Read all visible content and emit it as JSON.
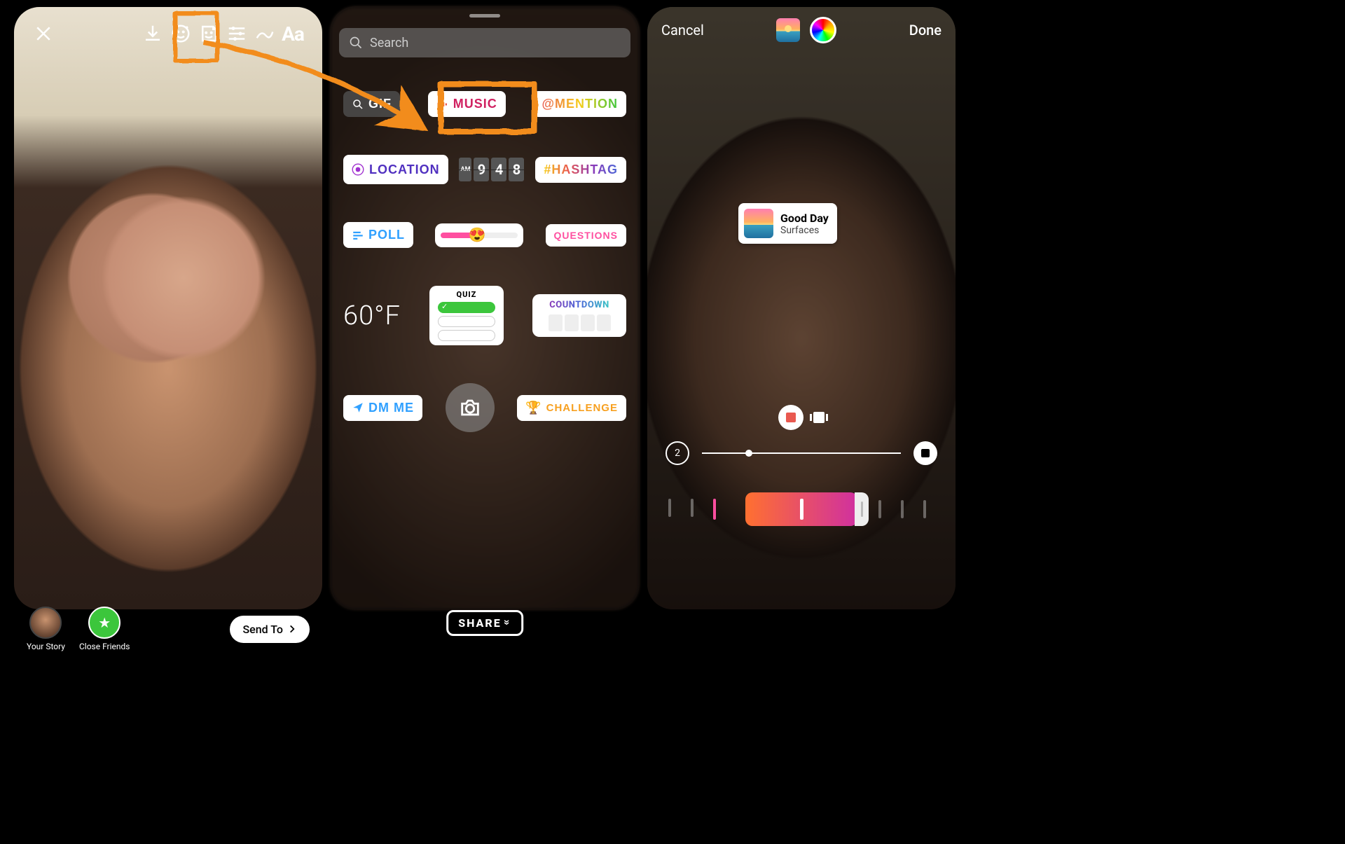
{
  "screen1": {
    "toolbar": {
      "text_tool": "Aa"
    },
    "bottom": {
      "your_story": "Your Story",
      "close_friends": "Close Friends",
      "send_to": "Send To"
    }
  },
  "screen2": {
    "search_placeholder": "Search",
    "row1": {
      "gif": "GIF",
      "music": "MUSIC",
      "mention": "@MENTION"
    },
    "row2": {
      "location": "LOCATION",
      "clock": {
        "ampm": "AM",
        "h": "9",
        "m1": "4",
        "m2": "8"
      },
      "hashtag": "#HASHTAG"
    },
    "row3": {
      "poll": "POLL",
      "questions": "QUESTIONS"
    },
    "row4": {
      "temp": "60°F",
      "quiz": "QUIZ",
      "countdown": "COUNTDOWN"
    },
    "row5": {
      "dm": "DM ME",
      "challenge": "CHALLENGE"
    },
    "share": "SHARE"
  },
  "screen3": {
    "cancel": "Cancel",
    "done": "Done",
    "song": {
      "title": "Good Day",
      "artist": "Surfaces"
    },
    "segment": "2"
  }
}
